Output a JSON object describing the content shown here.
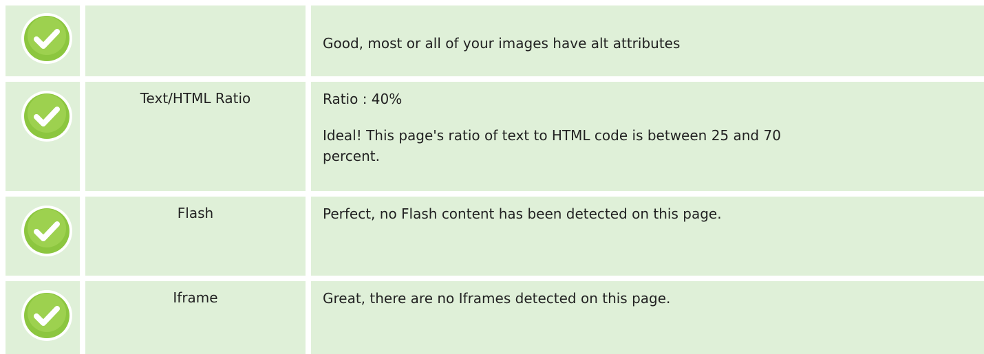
{
  "rows": [
    {
      "name": "",
      "status_icon": "check-circle-icon",
      "lines": [
        "Good, most or all of your images have alt attributes"
      ]
    },
    {
      "name": "Text/HTML Ratio",
      "status_icon": "check-circle-icon",
      "lines": [
        "Ratio : 40%",
        "Ideal! This page's ratio of text to HTML code is between 25 and 70 percent."
      ]
    },
    {
      "name": "Flash",
      "status_icon": "check-circle-icon",
      "lines": [
        "Perfect, no Flash content has been detected on this page."
      ]
    },
    {
      "name": "Iframe",
      "status_icon": "check-circle-icon",
      "lines": [
        "Great, there are no Iframes detected on this page."
      ]
    }
  ],
  "colors": {
    "row_background": "#dff0d8",
    "check_green": "#8cc63f"
  }
}
